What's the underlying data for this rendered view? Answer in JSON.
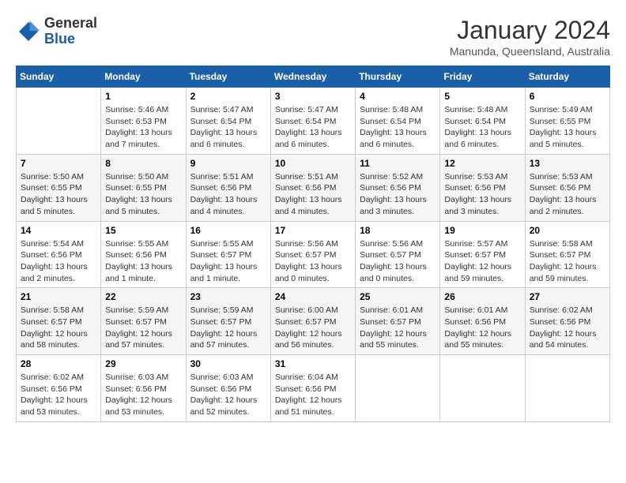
{
  "header": {
    "logo_line1": "General",
    "logo_line2": "Blue",
    "month": "January 2024",
    "location": "Manunda, Queensland, Australia"
  },
  "days_of_week": [
    "Sunday",
    "Monday",
    "Tuesday",
    "Wednesday",
    "Thursday",
    "Friday",
    "Saturday"
  ],
  "weeks": [
    [
      {
        "num": "",
        "sunrise": "",
        "sunset": "",
        "daylight": ""
      },
      {
        "num": "1",
        "sunrise": "Sunrise: 5:46 AM",
        "sunset": "Sunset: 6:53 PM",
        "daylight": "Daylight: 13 hours and 7 minutes."
      },
      {
        "num": "2",
        "sunrise": "Sunrise: 5:47 AM",
        "sunset": "Sunset: 6:54 PM",
        "daylight": "Daylight: 13 hours and 6 minutes."
      },
      {
        "num": "3",
        "sunrise": "Sunrise: 5:47 AM",
        "sunset": "Sunset: 6:54 PM",
        "daylight": "Daylight: 13 hours and 6 minutes."
      },
      {
        "num": "4",
        "sunrise": "Sunrise: 5:48 AM",
        "sunset": "Sunset: 6:54 PM",
        "daylight": "Daylight: 13 hours and 6 minutes."
      },
      {
        "num": "5",
        "sunrise": "Sunrise: 5:48 AM",
        "sunset": "Sunset: 6:54 PM",
        "daylight": "Daylight: 13 hours and 6 minutes."
      },
      {
        "num": "6",
        "sunrise": "Sunrise: 5:49 AM",
        "sunset": "Sunset: 6:55 PM",
        "daylight": "Daylight: 13 hours and 5 minutes."
      }
    ],
    [
      {
        "num": "7",
        "sunrise": "Sunrise: 5:50 AM",
        "sunset": "Sunset: 6:55 PM",
        "daylight": "Daylight: 13 hours and 5 minutes."
      },
      {
        "num": "8",
        "sunrise": "Sunrise: 5:50 AM",
        "sunset": "Sunset: 6:55 PM",
        "daylight": "Daylight: 13 hours and 5 minutes."
      },
      {
        "num": "9",
        "sunrise": "Sunrise: 5:51 AM",
        "sunset": "Sunset: 6:56 PM",
        "daylight": "Daylight: 13 hours and 4 minutes."
      },
      {
        "num": "10",
        "sunrise": "Sunrise: 5:51 AM",
        "sunset": "Sunset: 6:56 PM",
        "daylight": "Daylight: 13 hours and 4 minutes."
      },
      {
        "num": "11",
        "sunrise": "Sunrise: 5:52 AM",
        "sunset": "Sunset: 6:56 PM",
        "daylight": "Daylight: 13 hours and 3 minutes."
      },
      {
        "num": "12",
        "sunrise": "Sunrise: 5:53 AM",
        "sunset": "Sunset: 6:56 PM",
        "daylight": "Daylight: 13 hours and 3 minutes."
      },
      {
        "num": "13",
        "sunrise": "Sunrise: 5:53 AM",
        "sunset": "Sunset: 6:56 PM",
        "daylight": "Daylight: 13 hours and 2 minutes."
      }
    ],
    [
      {
        "num": "14",
        "sunrise": "Sunrise: 5:54 AM",
        "sunset": "Sunset: 6:56 PM",
        "daylight": "Daylight: 13 hours and 2 minutes."
      },
      {
        "num": "15",
        "sunrise": "Sunrise: 5:55 AM",
        "sunset": "Sunset: 6:56 PM",
        "daylight": "Daylight: 13 hours and 1 minute."
      },
      {
        "num": "16",
        "sunrise": "Sunrise: 5:55 AM",
        "sunset": "Sunset: 6:57 PM",
        "daylight": "Daylight: 13 hours and 1 minute."
      },
      {
        "num": "17",
        "sunrise": "Sunrise: 5:56 AM",
        "sunset": "Sunset: 6:57 PM",
        "daylight": "Daylight: 13 hours and 0 minutes."
      },
      {
        "num": "18",
        "sunrise": "Sunrise: 5:56 AM",
        "sunset": "Sunset: 6:57 PM",
        "daylight": "Daylight: 13 hours and 0 minutes."
      },
      {
        "num": "19",
        "sunrise": "Sunrise: 5:57 AM",
        "sunset": "Sunset: 6:57 PM",
        "daylight": "Daylight: 12 hours and 59 minutes."
      },
      {
        "num": "20",
        "sunrise": "Sunrise: 5:58 AM",
        "sunset": "Sunset: 6:57 PM",
        "daylight": "Daylight: 12 hours and 59 minutes."
      }
    ],
    [
      {
        "num": "21",
        "sunrise": "Sunrise: 5:58 AM",
        "sunset": "Sunset: 6:57 PM",
        "daylight": "Daylight: 12 hours and 58 minutes."
      },
      {
        "num": "22",
        "sunrise": "Sunrise: 5:59 AM",
        "sunset": "Sunset: 6:57 PM",
        "daylight": "Daylight: 12 hours and 57 minutes."
      },
      {
        "num": "23",
        "sunrise": "Sunrise: 5:59 AM",
        "sunset": "Sunset: 6:57 PM",
        "daylight": "Daylight: 12 hours and 57 minutes."
      },
      {
        "num": "24",
        "sunrise": "Sunrise: 6:00 AM",
        "sunset": "Sunset: 6:57 PM",
        "daylight": "Daylight: 12 hours and 56 minutes."
      },
      {
        "num": "25",
        "sunrise": "Sunrise: 6:01 AM",
        "sunset": "Sunset: 6:57 PM",
        "daylight": "Daylight: 12 hours and 55 minutes."
      },
      {
        "num": "26",
        "sunrise": "Sunrise: 6:01 AM",
        "sunset": "Sunset: 6:56 PM",
        "daylight": "Daylight: 12 hours and 55 minutes."
      },
      {
        "num": "27",
        "sunrise": "Sunrise: 6:02 AM",
        "sunset": "Sunset: 6:56 PM",
        "daylight": "Daylight: 12 hours and 54 minutes."
      }
    ],
    [
      {
        "num": "28",
        "sunrise": "Sunrise: 6:02 AM",
        "sunset": "Sunset: 6:56 PM",
        "daylight": "Daylight: 12 hours and 53 minutes."
      },
      {
        "num": "29",
        "sunrise": "Sunrise: 6:03 AM",
        "sunset": "Sunset: 6:56 PM",
        "daylight": "Daylight: 12 hours and 53 minutes."
      },
      {
        "num": "30",
        "sunrise": "Sunrise: 6:03 AM",
        "sunset": "Sunset: 6:56 PM",
        "daylight": "Daylight: 12 hours and 52 minutes."
      },
      {
        "num": "31",
        "sunrise": "Sunrise: 6:04 AM",
        "sunset": "Sunset: 6:56 PM",
        "daylight": "Daylight: 12 hours and 51 minutes."
      },
      {
        "num": "",
        "sunrise": "",
        "sunset": "",
        "daylight": ""
      },
      {
        "num": "",
        "sunrise": "",
        "sunset": "",
        "daylight": ""
      },
      {
        "num": "",
        "sunrise": "",
        "sunset": "",
        "daylight": ""
      }
    ]
  ]
}
